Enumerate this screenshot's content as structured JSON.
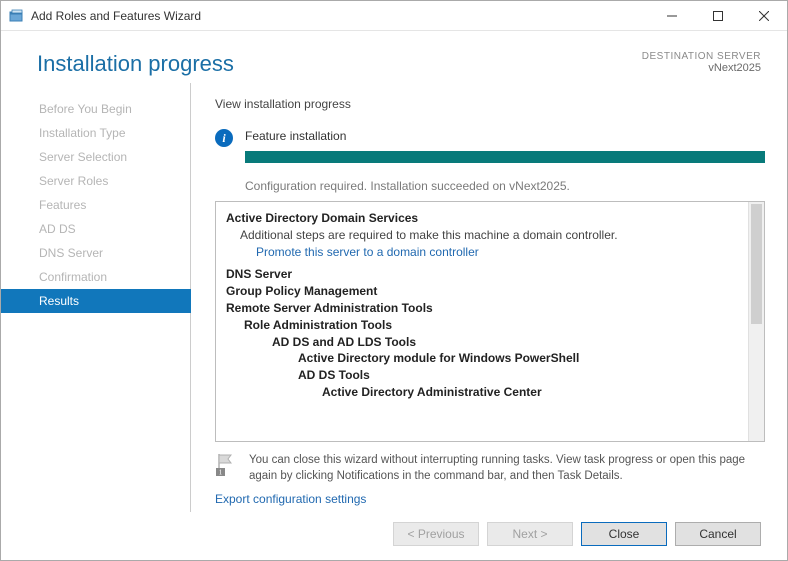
{
  "window": {
    "title": "Add Roles and Features Wizard"
  },
  "header": {
    "main_title": "Installation progress",
    "dest_server_label": "DESTINATION SERVER",
    "dest_server_name": "vNext2025"
  },
  "sidebar": {
    "items": [
      "Before You Begin",
      "Installation Type",
      "Server Selection",
      "Server Roles",
      "Features",
      "AD DS",
      "DNS Server",
      "Confirmation",
      "Results"
    ],
    "active_index": 8
  },
  "content": {
    "section_label": "View installation progress",
    "status_title": "Feature installation",
    "progress_percent": 100,
    "status_message": "Configuration required. Installation succeeded on vNext2025."
  },
  "details": {
    "adds_heading": "Active Directory Domain Services",
    "adds_note": "Additional steps are required to make this machine a domain controller.",
    "adds_link": "Promote this server to a domain controller",
    "dns_heading": "DNS Server",
    "gpm_heading": "Group Policy Management",
    "rsat_heading": "Remote Server Administration Tools",
    "rat_heading": "Role Administration Tools",
    "adlds_heading": "AD DS and AD LDS Tools",
    "adps_heading": "Active Directory module for Windows PowerShell",
    "addstools_heading": "AD DS Tools",
    "adac_heading": "Active Directory Administrative Center"
  },
  "notice": {
    "text": "You can close this wizard without interrupting running tasks. View task progress or open this page again by clicking Notifications in the command bar, and then Task Details."
  },
  "export_link": "Export configuration settings",
  "buttons": {
    "previous": "< Previous",
    "next": "Next >",
    "close": "Close",
    "cancel": "Cancel"
  }
}
